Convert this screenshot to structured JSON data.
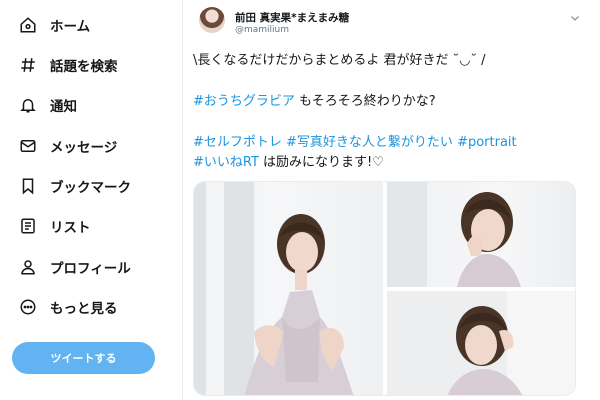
{
  "sidebar": {
    "items": [
      {
        "label": "ホーム",
        "icon": "home-icon"
      },
      {
        "label": "話題を検索",
        "icon": "hashtag-icon"
      },
      {
        "label": "通知",
        "icon": "bell-icon"
      },
      {
        "label": "メッセージ",
        "icon": "mail-icon"
      },
      {
        "label": "ブックマーク",
        "icon": "bookmark-icon"
      },
      {
        "label": "リスト",
        "icon": "list-icon"
      },
      {
        "label": "プロフィール",
        "icon": "person-icon"
      },
      {
        "label": "もっと見る",
        "icon": "more-icon"
      }
    ],
    "tweet_button": "ツイートする"
  },
  "tweet": {
    "display_name": "前田 真実果*まえまみ糖",
    "handle": "@mamilium",
    "line1": "\\長くなるだけだからまとめるよ 君が好きだ ˘◡˘ /",
    "line2_tag": "#おうちグラビア",
    "line2_text": " もそろそろ終わりかな?",
    "line3_tag1": "#セルフポトレ",
    "line3_tag2": " #写真好きな人と繋がりたい",
    "line3_tag3": " #portrait",
    "line4_tag": "#いいねRT",
    "line4_text": " は励みになります!♡"
  },
  "colors": {
    "accent": "#1b95e0",
    "tweet_button": "#61b3f1"
  }
}
